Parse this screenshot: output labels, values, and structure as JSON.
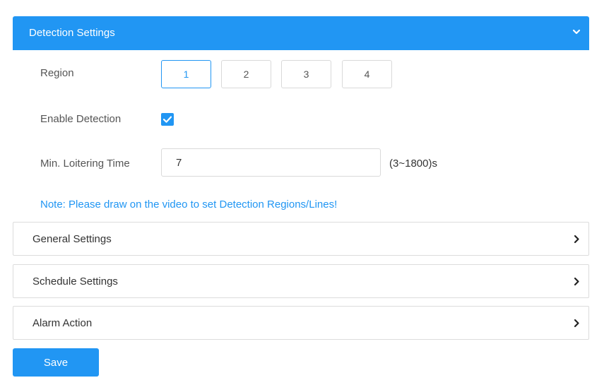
{
  "detection": {
    "title": "Detection Settings",
    "region_label": "Region",
    "regions": [
      "1",
      "2",
      "3",
      "4"
    ],
    "enable_label": "Enable Detection",
    "enable_checked": true,
    "min_time_label": "Min. Loitering Time",
    "min_time_value": "7",
    "min_time_range": "(3~1800)s",
    "note": "Note: Please draw on the video to set Detection Regions/Lines!"
  },
  "sections": {
    "general": "General Settings",
    "schedule": "Schedule Settings",
    "alarm": "Alarm Action"
  },
  "save_label": "Save",
  "colors": {
    "accent": "#2196f3",
    "border": "#d9d9d9"
  },
  "icons": {
    "header": "chevron-down-icon",
    "collapsed": "chevron-right-icon",
    "checkbox": "check-icon"
  }
}
